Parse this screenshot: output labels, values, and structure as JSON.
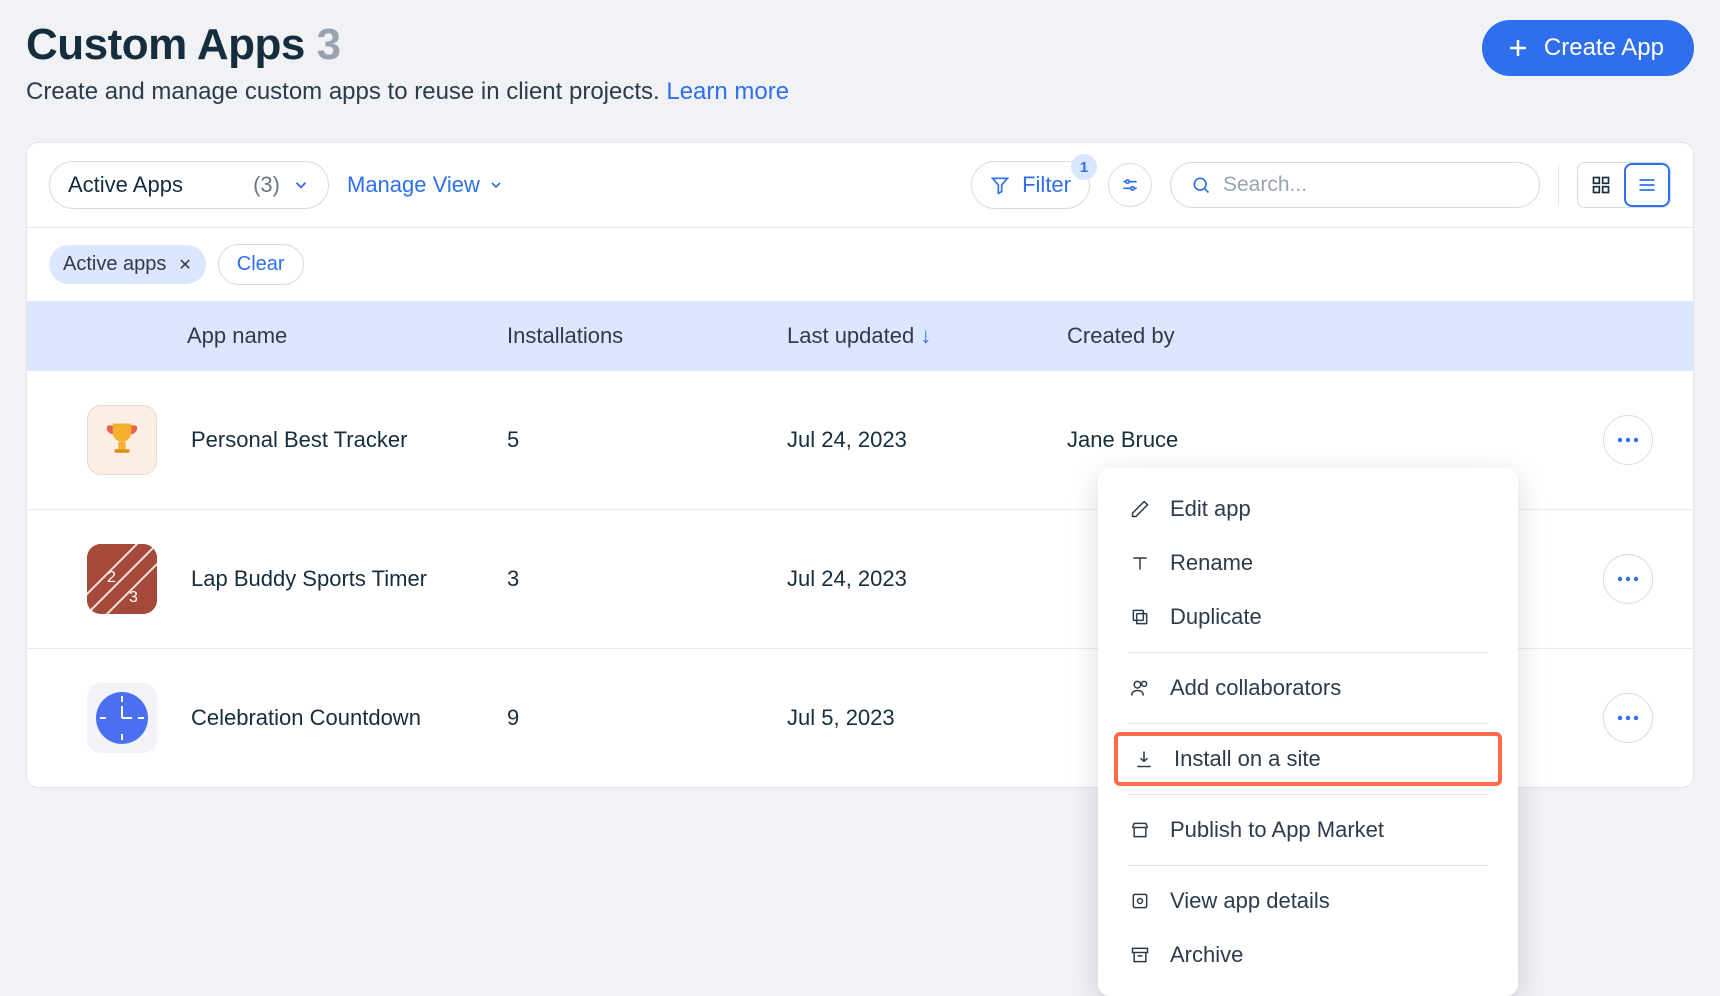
{
  "header": {
    "title": "Custom Apps",
    "count": "3",
    "subtitle": "Create and manage custom apps to reuse in client projects.",
    "learn_more": "Learn more",
    "create_label": "Create App"
  },
  "toolbar": {
    "view_label": "Active Apps",
    "view_count": "(3)",
    "manage_view": "Manage View",
    "filter_label": "Filter",
    "filter_badge": "1",
    "search_placeholder": "Search..."
  },
  "filters": {
    "chip": "Active apps",
    "clear": "Clear"
  },
  "table": {
    "columns": [
      "App name",
      "Installations",
      "Last updated",
      "Created by"
    ],
    "rows": [
      {
        "name": "Personal Best Tracker",
        "installs": "5",
        "updated": "Jul 24, 2023",
        "creator": "Jane Bruce",
        "icon": "trophy"
      },
      {
        "name": "Lap Buddy Sports Timer",
        "installs": "3",
        "updated": "Jul 24, 2023",
        "creator": "",
        "icon": "track"
      },
      {
        "name": "Celebration Countdown",
        "installs": "9",
        "updated": "Jul 5, 2023",
        "creator": "",
        "icon": "clock"
      }
    ]
  },
  "menu": {
    "edit": "Edit app",
    "rename": "Rename",
    "duplicate": "Duplicate",
    "collab": "Add collaborators",
    "install": "Install on a site",
    "publish": "Publish to App Market",
    "details": "View app details",
    "archive": "Archive"
  }
}
